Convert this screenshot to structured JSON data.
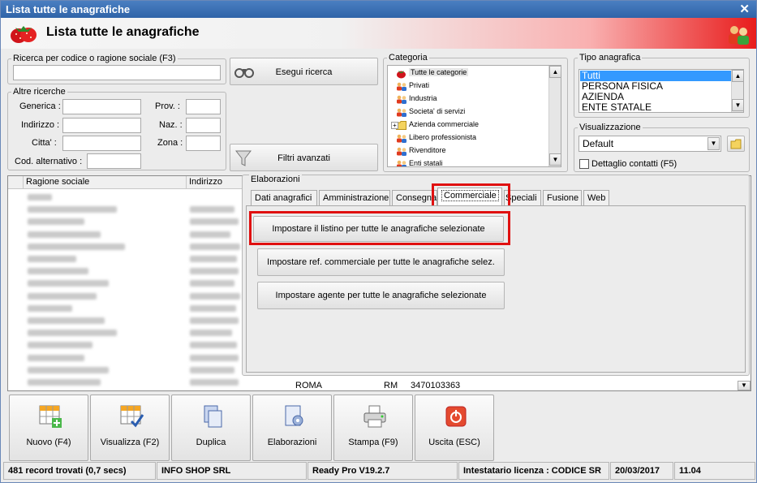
{
  "window": {
    "title": "Lista tutte le anagrafiche",
    "header_title": "Lista tutte le anagrafiche"
  },
  "search": {
    "legend": "Ricerca per codice o ragione sociale (F3)",
    "value": "",
    "search_button": "Esegui ricerca",
    "filter_button": "Filtri avanzati"
  },
  "other_search": {
    "legend": "Altre ricerche",
    "generica": "Generica :",
    "indirizzo": "Indirizzo :",
    "citta": "Citta' :",
    "cod_alt": "Cod. alternativo :",
    "prov": "Prov. :",
    "naz": "Naz. :",
    "zona": "Zona :"
  },
  "categoria": {
    "legend": "Categoria",
    "items": [
      {
        "label": "Tutte le categorie",
        "icon": "strawberry-icon"
      },
      {
        "label": "Privati",
        "icon": "people-icon"
      },
      {
        "label": "Industria",
        "icon": "people-icon"
      },
      {
        "label": "Societa' di servizi",
        "icon": "people-icon"
      },
      {
        "label": "Azienda commerciale",
        "icon": "folder-icon"
      },
      {
        "label": "Libero professionista",
        "icon": "people-icon"
      },
      {
        "label": "Rivenditore",
        "icon": "people-icon"
      },
      {
        "label": "Enti statali",
        "icon": "people-icon"
      }
    ]
  },
  "tipo": {
    "legend": "Tipo anagrafica",
    "items": [
      "Tutti",
      "PERSONA FISICA",
      "AZIENDA",
      "ENTE STATALE"
    ]
  },
  "visualizzazione": {
    "legend": "Visualizzazione",
    "selected": "Default",
    "dettaglio": "Dettaglio contatti (F5)"
  },
  "grid": {
    "col_ragione": "Ragione sociale",
    "col_indirizzo": "Indirizzo",
    "last_row": {
      "citta": "ROMA",
      "prov": "RM",
      "tel": "3470103363"
    }
  },
  "elaborazioni": {
    "legend": "Elaborazioni",
    "tabs": [
      "Dati anagrafici",
      "Amministrazione",
      "Consegna",
      "Commerciale",
      "Speciali",
      "Fusione",
      "Web"
    ],
    "selected_tab": "Commerciale",
    "buttons": [
      "Impostare il listino per tutte le anagrafiche selezionate",
      "Impostare ref. commerciale per tutte le anagrafiche selez.",
      "Impostare agente per tutte le anagrafiche selezionate"
    ]
  },
  "toolbar": {
    "nuovo": "Nuovo (F4)",
    "visualizza": "Visualizza (F2)",
    "duplica": "Duplica",
    "elaborazioni": "Elaborazioni",
    "stampa": "Stampa (F9)",
    "uscita": "Uscita (ESC)"
  },
  "status": {
    "records": "481 record trovati (0,7 secs)",
    "company": "INFO SHOP SRL",
    "version": "Ready Pro V19.2.7",
    "license": "Intestatario licenza : CODICE SR",
    "date": "20/03/2017",
    "time": "11.04"
  }
}
